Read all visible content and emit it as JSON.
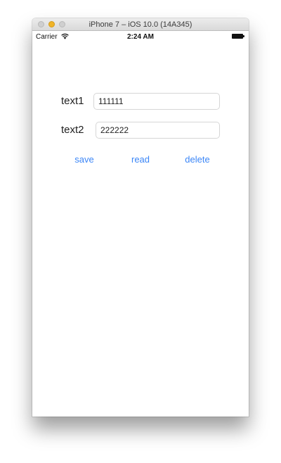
{
  "window": {
    "title": "iPhone 7 – iOS 10.0 (14A345)"
  },
  "status_bar": {
    "carrier": "Carrier",
    "time": "2:24 AM",
    "wifi_icon": "wifi-icon",
    "battery_icon": "battery-icon",
    "battery_level": 1.0
  },
  "form": {
    "fields": [
      {
        "label": "text1",
        "value": "111111"
      },
      {
        "label": "text2",
        "value": "222222"
      }
    ]
  },
  "actions": {
    "save": "save",
    "read": "read",
    "delete": "delete"
  },
  "colors": {
    "accent": "#3b86f7",
    "minimize_button": "#f0b429"
  }
}
